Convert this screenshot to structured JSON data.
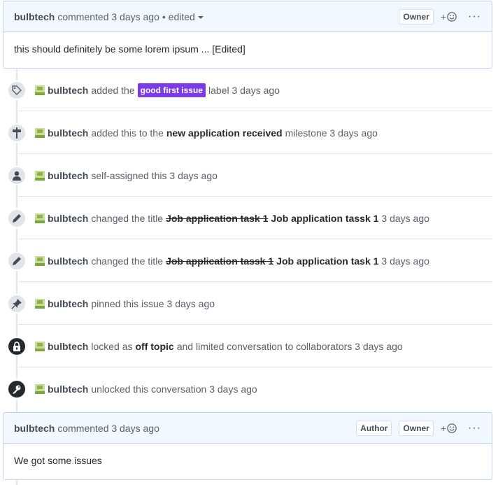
{
  "comments": [
    {
      "author": "bulbtech",
      "meta": "commented 3 days ago",
      "edited": "• edited",
      "badges": [
        "Owner"
      ],
      "reaction": "+",
      "body": "this should definitely be some lorem ipsum ... [Edited]"
    },
    {
      "author": "bulbtech",
      "meta": "commented 3 days ago",
      "badges": [
        "Author",
        "Owner"
      ],
      "reaction": "+",
      "body": "We got some issues"
    }
  ],
  "events": [
    {
      "icon": "tag-icon",
      "author": "bulbtech",
      "parts": [
        {
          "t": "txt",
          "v": "added the"
        },
        {
          "t": "label",
          "v": "good first issue"
        },
        {
          "t": "txt",
          "v": "label 3 days ago"
        }
      ]
    },
    {
      "icon": "milestone-icon",
      "author": "bulbtech",
      "parts": [
        {
          "t": "txt",
          "v": "added this to the"
        },
        {
          "t": "strong",
          "v": "new application received"
        },
        {
          "t": "txt",
          "v": "milestone 3 days ago"
        }
      ]
    },
    {
      "icon": "person-icon",
      "author": "bulbtech",
      "parts": [
        {
          "t": "txt",
          "v": "self-assigned this 3 days ago"
        }
      ]
    },
    {
      "icon": "pencil-icon",
      "author": "bulbtech",
      "parts": [
        {
          "t": "txt",
          "v": "changed the title"
        },
        {
          "t": "strike",
          "v": "Job application task 1"
        },
        {
          "t": "strong",
          "v": "Job application tassk 1"
        },
        {
          "t": "txt",
          "v": "3 days ago"
        }
      ]
    },
    {
      "icon": "pencil-icon",
      "author": "bulbtech",
      "parts": [
        {
          "t": "txt",
          "v": "changed the title"
        },
        {
          "t": "strike",
          "v": "Job application tassk 1"
        },
        {
          "t": "strong",
          "v": "Job application task 1"
        },
        {
          "t": "txt",
          "v": "3 days ago"
        }
      ]
    },
    {
      "icon": "pin-icon",
      "author": "bulbtech",
      "parts": [
        {
          "t": "txt",
          "v": "pinned this issue 3 days ago"
        }
      ]
    },
    {
      "icon": "lock-icon",
      "author": "bulbtech",
      "parts": [
        {
          "t": "txt",
          "v": "locked as"
        },
        {
          "t": "strong",
          "v": "off topic"
        },
        {
          "t": "txt",
          "v": "and limited conversation to collaborators 3 days ago"
        }
      ]
    },
    {
      "icon": "key-icon",
      "author": "bulbtech",
      "parts": [
        {
          "t": "txt",
          "v": "unlocked this conversation 3 days ago"
        }
      ]
    }
  ],
  "colors": {
    "label_bg": "#7c3aed",
    "header_bg": "#f1f8ff",
    "border": "#c0d3eb"
  }
}
